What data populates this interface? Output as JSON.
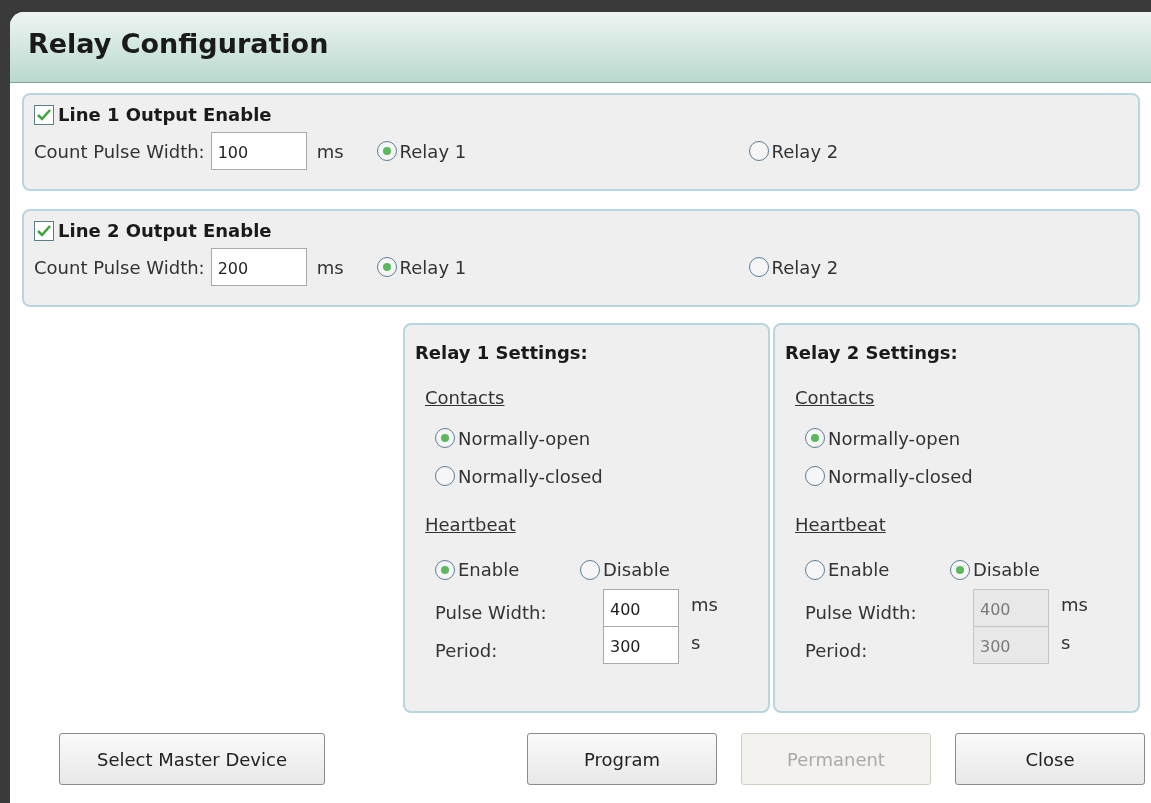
{
  "window": {
    "title": "Relay Configuration"
  },
  "lines": [
    {
      "label": "Line 1 Output Enable",
      "checked": true,
      "pulse_label": "Count Pulse Width:",
      "value": "100",
      "unit": "ms",
      "relays": [
        {
          "label": "Relay 1",
          "selected": true
        },
        {
          "label": "Relay 2",
          "selected": false
        }
      ]
    },
    {
      "label": "Line 2 Output Enable",
      "checked": true,
      "pulse_label": "Count Pulse Width:",
      "value": "200",
      "unit": "ms",
      "relays": [
        {
          "label": "Relay 1",
          "selected": true
        },
        {
          "label": "Relay 2",
          "selected": false
        }
      ]
    }
  ],
  "relay_settings": [
    {
      "title": "Relay 1 Settings:",
      "contacts_heading": "Contacts",
      "contacts": [
        {
          "label": "Normally-open",
          "selected": true
        },
        {
          "label": "Normally-closed",
          "selected": false
        }
      ],
      "heartbeat_heading": "Heartbeat",
      "heartbeat": [
        {
          "label": "Enable",
          "selected": true
        },
        {
          "label": "Disable",
          "selected": false
        }
      ],
      "fields": [
        {
          "label": "Pulse Width:",
          "value": "400",
          "unit": "ms",
          "disabled": false
        },
        {
          "label": "Period:",
          "value": "300",
          "unit": "s",
          "disabled": false
        }
      ]
    },
    {
      "title": "Relay 2 Settings:",
      "contacts_heading": "Contacts",
      "contacts": [
        {
          "label": "Normally-open",
          "selected": true
        },
        {
          "label": "Normally-closed",
          "selected": false
        }
      ],
      "heartbeat_heading": "Heartbeat",
      "heartbeat": [
        {
          "label": "Enable",
          "selected": false
        },
        {
          "label": "Disable",
          "selected": true
        }
      ],
      "fields": [
        {
          "label": "Pulse Width:",
          "value": "400",
          "unit": "ms",
          "disabled": true
        },
        {
          "label": "Period:",
          "value": "300",
          "unit": "s",
          "disabled": true
        }
      ]
    }
  ],
  "buttons": [
    {
      "label": "Select Master Device",
      "disabled": false
    },
    {
      "label": "Program",
      "disabled": false
    },
    {
      "label": "Permanent",
      "disabled": true
    },
    {
      "label": "Close",
      "disabled": false
    }
  ]
}
